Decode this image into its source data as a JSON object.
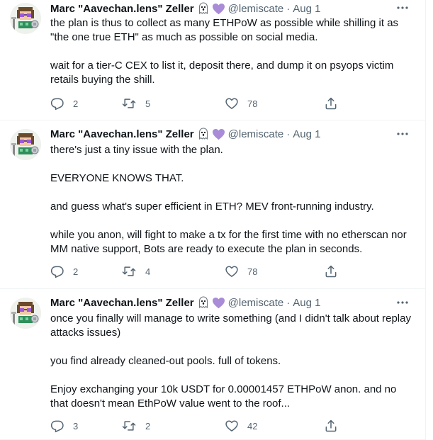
{
  "tweets": [
    {
      "display_name": "Marc \"Aavechan.lens\" Zeller",
      "handle": "@lemiscate",
      "separator": "·",
      "time": "Aug 1",
      "paragraphs": [
        "the plan is thus to collect as many ETHPoW as possible while shilling it as \"the one true ETH\" as much as possible on social media.",
        "wait for a tier-C CEX to list it, deposit there, and dump it on psyops victim retails buying the shill."
      ],
      "replies": "2",
      "retweets": "5",
      "likes": "78"
    },
    {
      "display_name": "Marc \"Aavechan.lens\" Zeller",
      "handle": "@lemiscate",
      "separator": "·",
      "time": "Aug 1",
      "paragraphs": [
        "there's just a tiny issue with the plan.",
        "EVERYONE KNOWS THAT.",
        "and guess what's super efficient in ETH? MEV front-running industry.",
        "while you anon, will fight to make a tx for the first time with no etherscan nor MM native support, Bots are ready to execute the plan in seconds."
      ],
      "replies": "2",
      "retweets": "4",
      "likes": "78"
    },
    {
      "display_name": "Marc \"Aavechan.lens\" Zeller",
      "handle": "@lemiscate",
      "separator": "·",
      "time": "Aug 1",
      "paragraphs": [
        "once you finally will manage to write something (and I didn't talk about replay attacks issues)",
        "you find already cleaned-out pools. full of tokens.",
        "Enjoy exchanging your 10k USDT for 0.00001457 ETHPoW anon. and no that doesn't mean EthPoW value went to the roof..."
      ],
      "replies": "3",
      "retweets": "2",
      "likes": "42"
    }
  ],
  "colors": {
    "text_primary": "#0f1419",
    "text_secondary": "#536471",
    "heart_badge": "#a98bd8",
    "border": "#eff3f4"
  },
  "icons": {
    "ghost_badge": "ghost-icon",
    "heart_badge": "purple-heart-icon",
    "more": "more-dots-icon",
    "reply": "reply-icon",
    "retweet": "retweet-icon",
    "like": "like-icon",
    "share": "share-icon"
  }
}
